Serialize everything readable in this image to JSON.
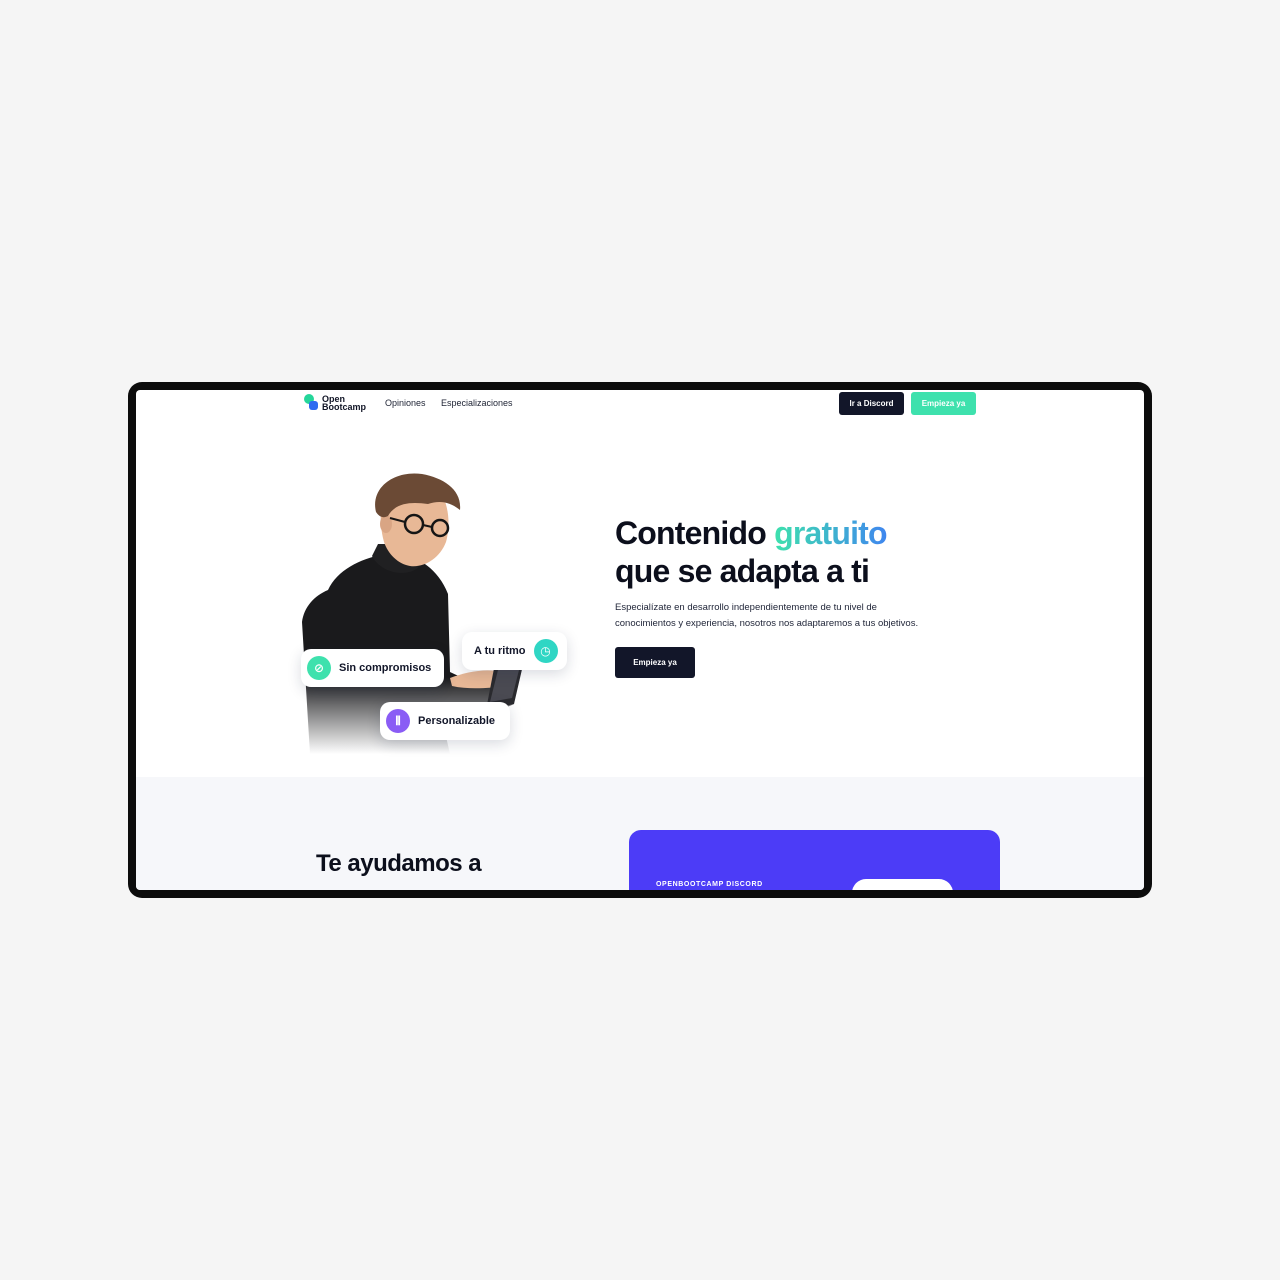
{
  "nav": {
    "logo_line1": "Open",
    "logo_line2": "Bootcamp",
    "links": [
      "Opiniones",
      "Especializaciones"
    ],
    "discord_button": "Ir a Discord",
    "start_button": "Empieza ya"
  },
  "hero": {
    "title_part1": "Contenido ",
    "title_highlight": "gratuito",
    "title_line2": "que se adapta a ti",
    "subtitle_line1": "Especialízate en desarrollo independientemente de tu nivel de",
    "subtitle_line2": "conocimientos y experiencia, nosotros nos adaptaremos a tus objetivos.",
    "cta": "Empieza ya",
    "pills": [
      {
        "label": "Sin compromisos",
        "icon": "no-commitment-icon",
        "color": "#3ee1ad"
      },
      {
        "label": "A tu ritmo",
        "icon": "clock-pace-icon",
        "color": "#2fd6c4"
      },
      {
        "label": "Personalizable",
        "icon": "customize-icon",
        "color": "#8a5cf5"
      }
    ]
  },
  "section2": {
    "title": "Te ayudamos a",
    "card_label": "OPENBOOTCAMP DISCORD",
    "card_color": "#4c3cf7"
  },
  "colors": {
    "dark": "#121629",
    "accent_green": "#3ee1ad",
    "accent_blue": "#3f86ef"
  }
}
